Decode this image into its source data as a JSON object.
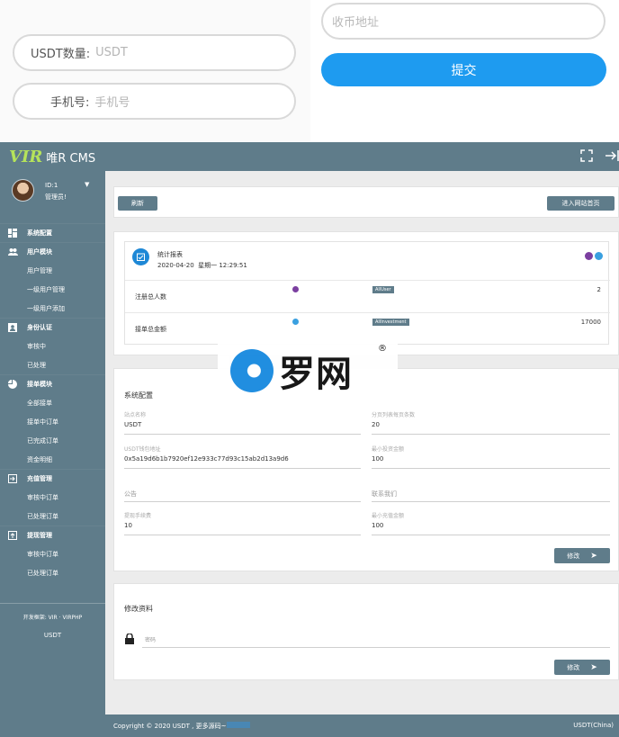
{
  "mobile_form": {
    "usdt_label": "USDT数量:",
    "usdt_placeholder": "USDT",
    "phone_label": "手机号:",
    "phone_placeholder": "手机号",
    "address_placeholder": "收币地址",
    "submit_label": "提交"
  },
  "header": {
    "logo_mark": "VIR",
    "logo_rest": "唯R CMS",
    "fullscreen_icon": "fullscreen-icon",
    "logout_icon": "logout-icon"
  },
  "user": {
    "id_text": "ID:1",
    "role_text": "管理员!"
  },
  "sidebar": {
    "items": [
      {
        "label": "系统配置",
        "icon": "dashboard-icon"
      },
      {
        "label": "用户模块",
        "icon": "users-icon"
      },
      {
        "label": "用户管理"
      },
      {
        "label": "一级用户管理"
      },
      {
        "label": "一级用户添加"
      },
      {
        "label": "身份认证",
        "icon": "id-card-icon"
      },
      {
        "label": "审核中"
      },
      {
        "label": "已处理"
      },
      {
        "label": "接单模块",
        "icon": "pie-icon"
      },
      {
        "label": "全部接单"
      },
      {
        "label": "接单中订单"
      },
      {
        "label": "已完成订单"
      },
      {
        "label": "资金明细"
      },
      {
        "label": "充值管理",
        "icon": "login-box-icon"
      },
      {
        "label": "审核中订单"
      },
      {
        "label": "已处理订单"
      },
      {
        "label": "提现管理",
        "icon": "upload-box-icon"
      },
      {
        "label": "审核中订单"
      },
      {
        "label": "已处理订单"
      }
    ],
    "footer_dev": "开发框架: VIR · VIRPHP",
    "footer_currency": "USDT"
  },
  "toolbar": {
    "refresh_label": "刷新",
    "home_label": "进入网站首页"
  },
  "stats": {
    "title": "统计报表",
    "datetime": "2020-04-20  星期一 12:29:51",
    "rows": [
      {
        "label": "注册总人数",
        "tag": "AllUser",
        "value": "2"
      },
      {
        "label": "接单总金额",
        "tag": "AllInvestment",
        "value": "17000"
      }
    ]
  },
  "settings": {
    "title": "系统配置",
    "fields": {
      "site_name_label": "站点名称",
      "site_name_value": "USDT",
      "page_size_label": "分页列表每页条数",
      "page_size_value": "20",
      "wallet_label": "USDT钱包地址",
      "wallet_value": "0x5a19d6b1b7920ef12e933c77d93c15ab2d13a9d6",
      "min_invest_label": "最小投资金额",
      "min_invest_value": "100",
      "notice_placeholder": "公告",
      "contact_placeholder": "联系我们",
      "fee_label": "提现手续费",
      "fee_value": "10",
      "min_recharge_label": "最小充值金额",
      "min_recharge_value": "100"
    },
    "submit_label": "修改"
  },
  "profile": {
    "title": "修改资料",
    "password_placeholder": "密码",
    "submit_label": "修改"
  },
  "footer": {
    "left_text": "Copyright © 2020 USDT , 更多源码~",
    "right_text": "USDT(China)"
  },
  "watermark": {
    "text": "罗网",
    "reg": "®"
  },
  "colors": {
    "primary_blue": "#1e9bf0",
    "slate": "#5f7c8a",
    "logo_green": "#b5e35a"
  }
}
